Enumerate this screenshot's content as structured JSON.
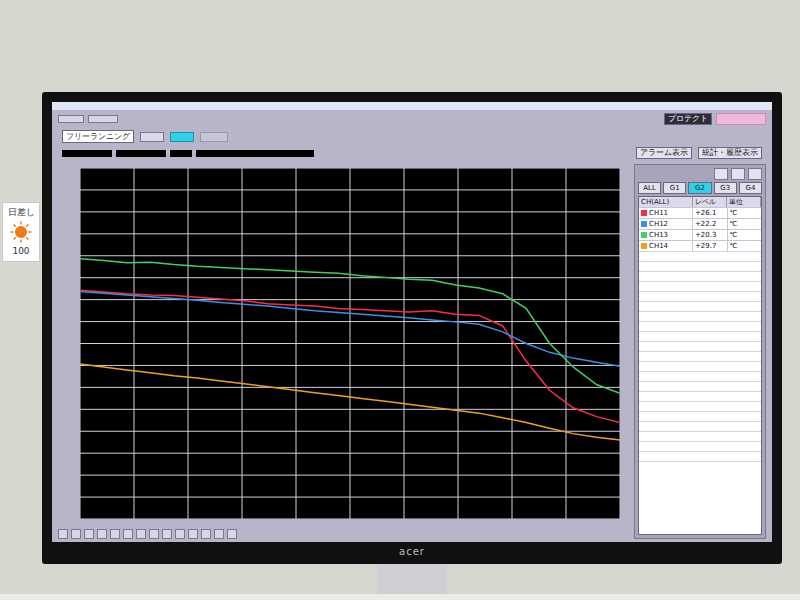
{
  "sign": {
    "label": "日差し",
    "value": "100"
  },
  "monitor": {
    "brand": "acer"
  },
  "app": {
    "protect_button": "プロテクト",
    "mode_field": "フリーランニング",
    "display_buttons": [
      "アラーム表示",
      "統計・履歴表示"
    ],
    "group_tabs": [
      {
        "label": "ALL",
        "selected": false
      },
      {
        "label": "G1",
        "selected": false
      },
      {
        "label": "G2",
        "selected": true
      },
      {
        "label": "G3",
        "selected": false
      },
      {
        "label": "G4",
        "selected": false
      }
    ],
    "table": {
      "columns": [
        "CH(ALL)",
        "レベル",
        "単位"
      ],
      "rows": [
        {
          "channel": "CH11",
          "value": "+26.1",
          "unit": "℃",
          "color": "#ff2a4a",
          "values": [
            39.1,
            38.8,
            38.5,
            38.3,
            38.2,
            37.9,
            37.6,
            37.3,
            36.8,
            36.6,
            36.4,
            36.0,
            35.8,
            35.6,
            35.4,
            35.6,
            35.0,
            34.8,
            33.0,
            27.0,
            22.0,
            19.0,
            17.5,
            16.5
          ]
        },
        {
          "channel": "CH12",
          "value": "+22.2",
          "unit": "℃",
          "color": "#3a8fe8",
          "values": [
            38.9,
            38.6,
            38.3,
            38.0,
            37.7,
            37.4,
            37.0,
            36.7,
            36.4,
            36.0,
            35.6,
            35.3,
            35.0,
            34.7,
            34.4,
            34.0,
            33.7,
            33.3,
            32.0,
            30.0,
            28.5,
            27.5,
            26.8,
            26.1
          ]
        },
        {
          "channel": "CH13",
          "value": "+20.3",
          "unit": "℃",
          "color": "#40d060",
          "values": [
            44.5,
            44.2,
            43.8,
            43.9,
            43.5,
            43.2,
            43.0,
            42.8,
            42.6,
            42.4,
            42.2,
            42.0,
            41.6,
            41.3,
            41.0,
            40.8,
            40.0,
            39.5,
            38.5,
            36.0,
            30.0,
            26.0,
            23.0,
            21.5
          ]
        },
        {
          "channel": "CH14",
          "value": "+29.7",
          "unit": "℃",
          "color": "#f0a020",
          "values": [
            26.5,
            26.0,
            25.5,
            25.0,
            24.5,
            24.1,
            23.6,
            23.1,
            22.6,
            22.1,
            21.6,
            21.1,
            20.6,
            20.1,
            19.6,
            19.1,
            18.6,
            18.1,
            17.3,
            16.5,
            15.5,
            14.6,
            14.0,
            13.5
          ]
        }
      ]
    }
  }
}
